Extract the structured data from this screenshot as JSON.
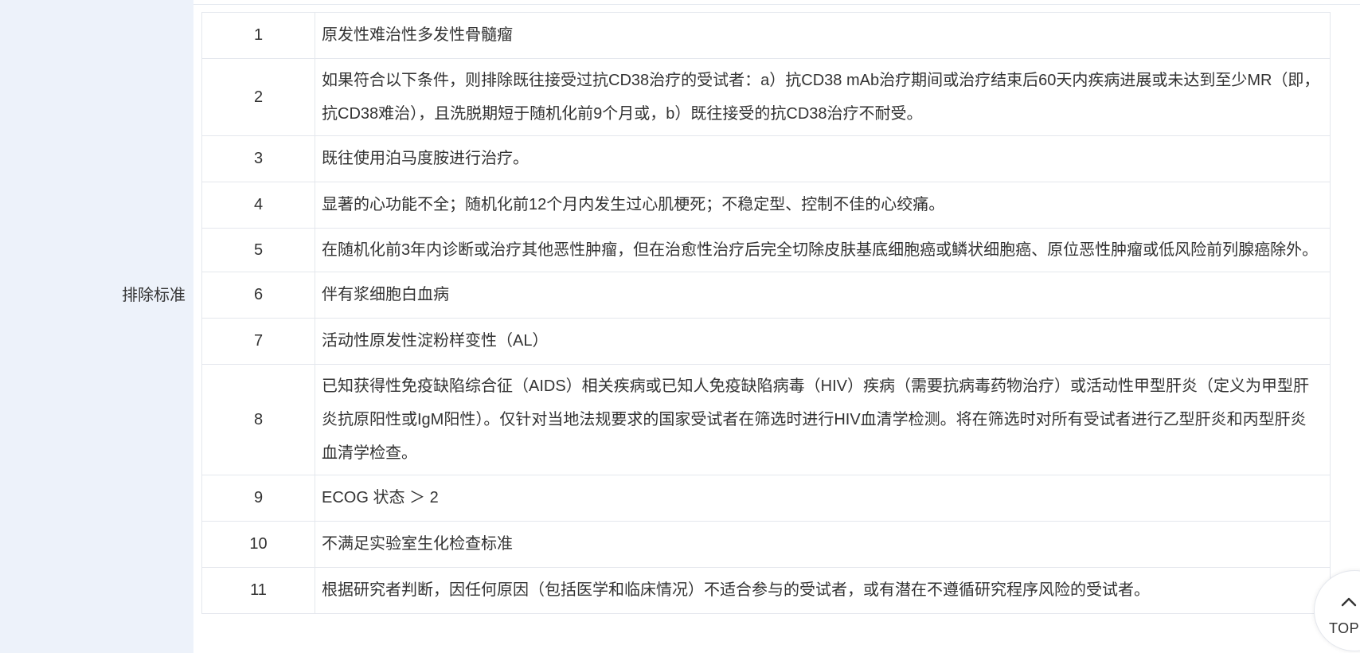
{
  "section": {
    "label": "排除标准"
  },
  "rows": [
    {
      "num": "1",
      "text": "原发性难治性多发性骨髓瘤"
    },
    {
      "num": "2",
      "text": "如果符合以下条件，则排除既往接受过抗CD38治疗的受试者：a）抗CD38 mAb治疗期间或治疗结束后60天内疾病进展或未达到至少MR（即，抗CD38难治），且洗脱期短于随机化前9个月或，b）既往接受的抗CD38治疗不耐受。"
    },
    {
      "num": "3",
      "text": "既往使用泊马度胺进行治疗。"
    },
    {
      "num": "4",
      "text": "显著的心功能不全；随机化前12个月内发生过心肌梗死；不稳定型、控制不佳的心绞痛。"
    },
    {
      "num": "5",
      "text": "在随机化前3年内诊断或治疗其他恶性肿瘤，但在治愈性治疗后完全切除皮肤基底细胞癌或鳞状细胞癌、原位恶性肿瘤或低风险前列腺癌除外。"
    },
    {
      "num": "6",
      "text": "伴有浆细胞白血病"
    },
    {
      "num": "7",
      "text": "活动性原发性淀粉样变性（AL）"
    },
    {
      "num": "8",
      "text": "已知获得性免疫缺陷综合征（AIDS）相关疾病或已知人免疫缺陷病毒（HIV）疾病（需要抗病毒药物治疗）或活动性甲型肝炎（定义为甲型肝炎抗原阳性或IgM阳性）。仅针对当地法规要求的国家受试者在筛选时进行HIV血清学检测。将在筛选时对所有受试者进行乙型肝炎和丙型肝炎血清学检查。"
    },
    {
      "num": "9",
      "text": "ECOG 状态 ＞ 2"
    },
    {
      "num": "10",
      "text": "不满足实验室生化检查标准"
    },
    {
      "num": "11",
      "text": "根据研究者判断，因任何原因（包括医学和临床情况）不适合参与的受试者，或有潜在不遵循研究程序风险的受试者。"
    }
  ],
  "top_button": {
    "label": "TOP",
    "icon": "chevron-up-icon"
  },
  "colors": {
    "label_column_bg": "#edf2fa",
    "border": "#e4e7ed",
    "text": "#333333"
  }
}
